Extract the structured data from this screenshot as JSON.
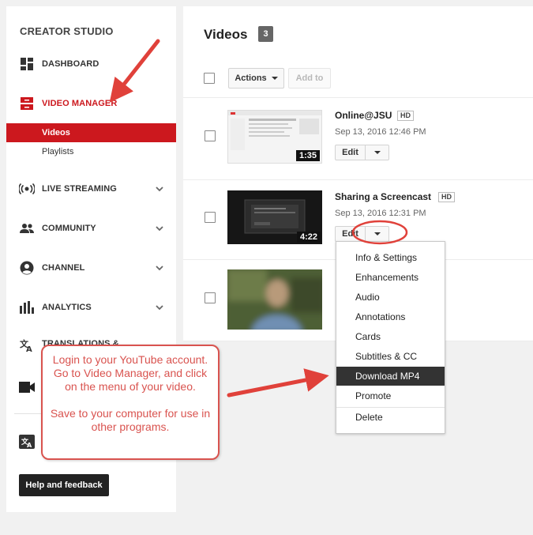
{
  "sidebar": {
    "brand": "CREATOR STUDIO",
    "items": [
      {
        "label": "DASHBOARD"
      },
      {
        "label": "VIDEO MANAGER"
      },
      {
        "label": "LIVE STREAMING"
      },
      {
        "label": "COMMUNITY"
      },
      {
        "label": "CHANNEL"
      },
      {
        "label": "ANALYTICS"
      },
      {
        "label": "TRANSLATIONS &"
      }
    ],
    "sub_items": [
      {
        "label": "Videos"
      },
      {
        "label": "Playlists"
      }
    ],
    "help_label": "Help and feedback"
  },
  "main": {
    "title": "Videos",
    "count": "3",
    "actions_label": "Actions",
    "add_to_label": "Add to",
    "videos": [
      {
        "title": "Online@JSU",
        "badge": "HD",
        "date": "Sep 13, 2016 12:46 PM",
        "duration": "1:35",
        "edit_label": "Edit"
      },
      {
        "title": "Sharing a Screencast",
        "badge": "HD",
        "date": "Sep 13, 2016 12:31 PM",
        "duration": "4:22",
        "edit_label": "Edit"
      },
      {
        "title": "",
        "badge": "",
        "date": "",
        "duration": ""
      }
    ]
  },
  "dropdown": {
    "items": [
      {
        "label": "Info & Settings"
      },
      {
        "label": "Enhancements"
      },
      {
        "label": "Audio"
      },
      {
        "label": "Annotations"
      },
      {
        "label": "Cards"
      },
      {
        "label": "Subtitles & CC"
      },
      {
        "label": "Download MP4"
      },
      {
        "label": "Promote"
      },
      {
        "label": "Delete"
      }
    ],
    "highlighted": "Download MP4"
  },
  "annotation": {
    "line1": "Login to your YouTube account. Go to Video Manager, and click on the menu of your video.",
    "line2": "Save to your computer for use in other programs."
  },
  "colors": {
    "accent": "#cc181e",
    "annotation": "#d9534f",
    "menu_highlight": "#333333"
  }
}
